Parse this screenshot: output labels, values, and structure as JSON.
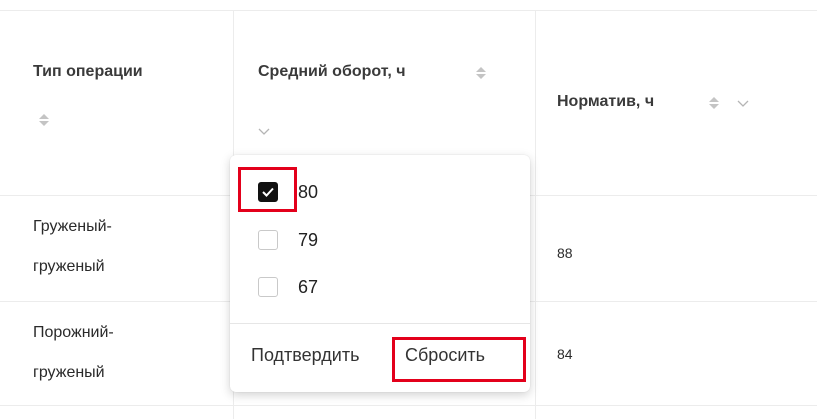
{
  "table": {
    "columns": [
      {
        "label": "Тип операции"
      },
      {
        "label": "Средний оборот, ч"
      },
      {
        "label": "Норматив, ч"
      }
    ],
    "rows": [
      {
        "type_line1": "Груженый-",
        "type_line2": "груженый",
        "norm": "88"
      },
      {
        "type_line1": "Порожний-",
        "type_line2": "груженый",
        "norm": "84"
      }
    ]
  },
  "filter_dropdown": {
    "options": [
      {
        "label": "80",
        "checked": true
      },
      {
        "label": "79",
        "checked": false
      },
      {
        "label": "67",
        "checked": false
      }
    ],
    "confirm_label": "Подтвердить",
    "reset_label": "Сбросить"
  },
  "colors": {
    "highlight": "#e3001b",
    "checkbox_checked": "#111111",
    "grid_line": "#ececec"
  }
}
